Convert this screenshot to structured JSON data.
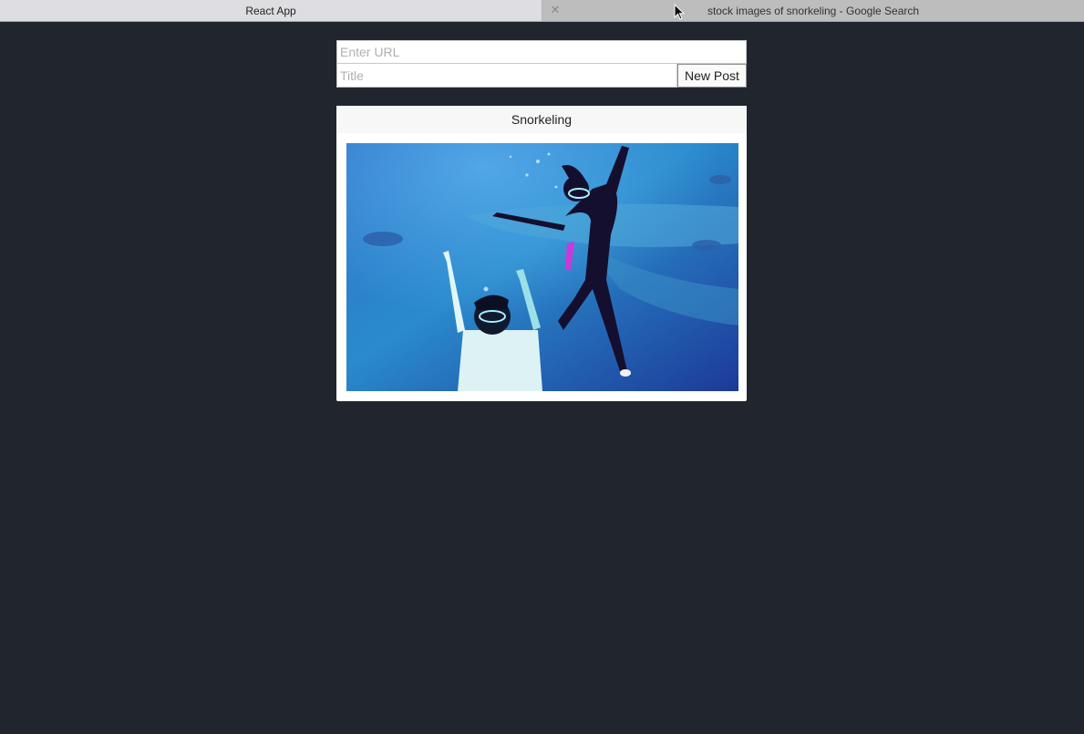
{
  "tabs": [
    {
      "title": "React App",
      "active": true
    },
    {
      "title": "stock images of snorkeling - Google Search",
      "active": false
    }
  ],
  "form": {
    "url_placeholder": "Enter URL",
    "url_value": "",
    "title_placeholder": "Title",
    "title_value": "",
    "submit_label": "New Post"
  },
  "posts": [
    {
      "title": "Snorkeling",
      "image_icon": "snorkeling-photo"
    }
  ],
  "colors": {
    "background": "#21252e",
    "water_deep": "#1d3f9a",
    "water_light": "#2c8fd0"
  }
}
